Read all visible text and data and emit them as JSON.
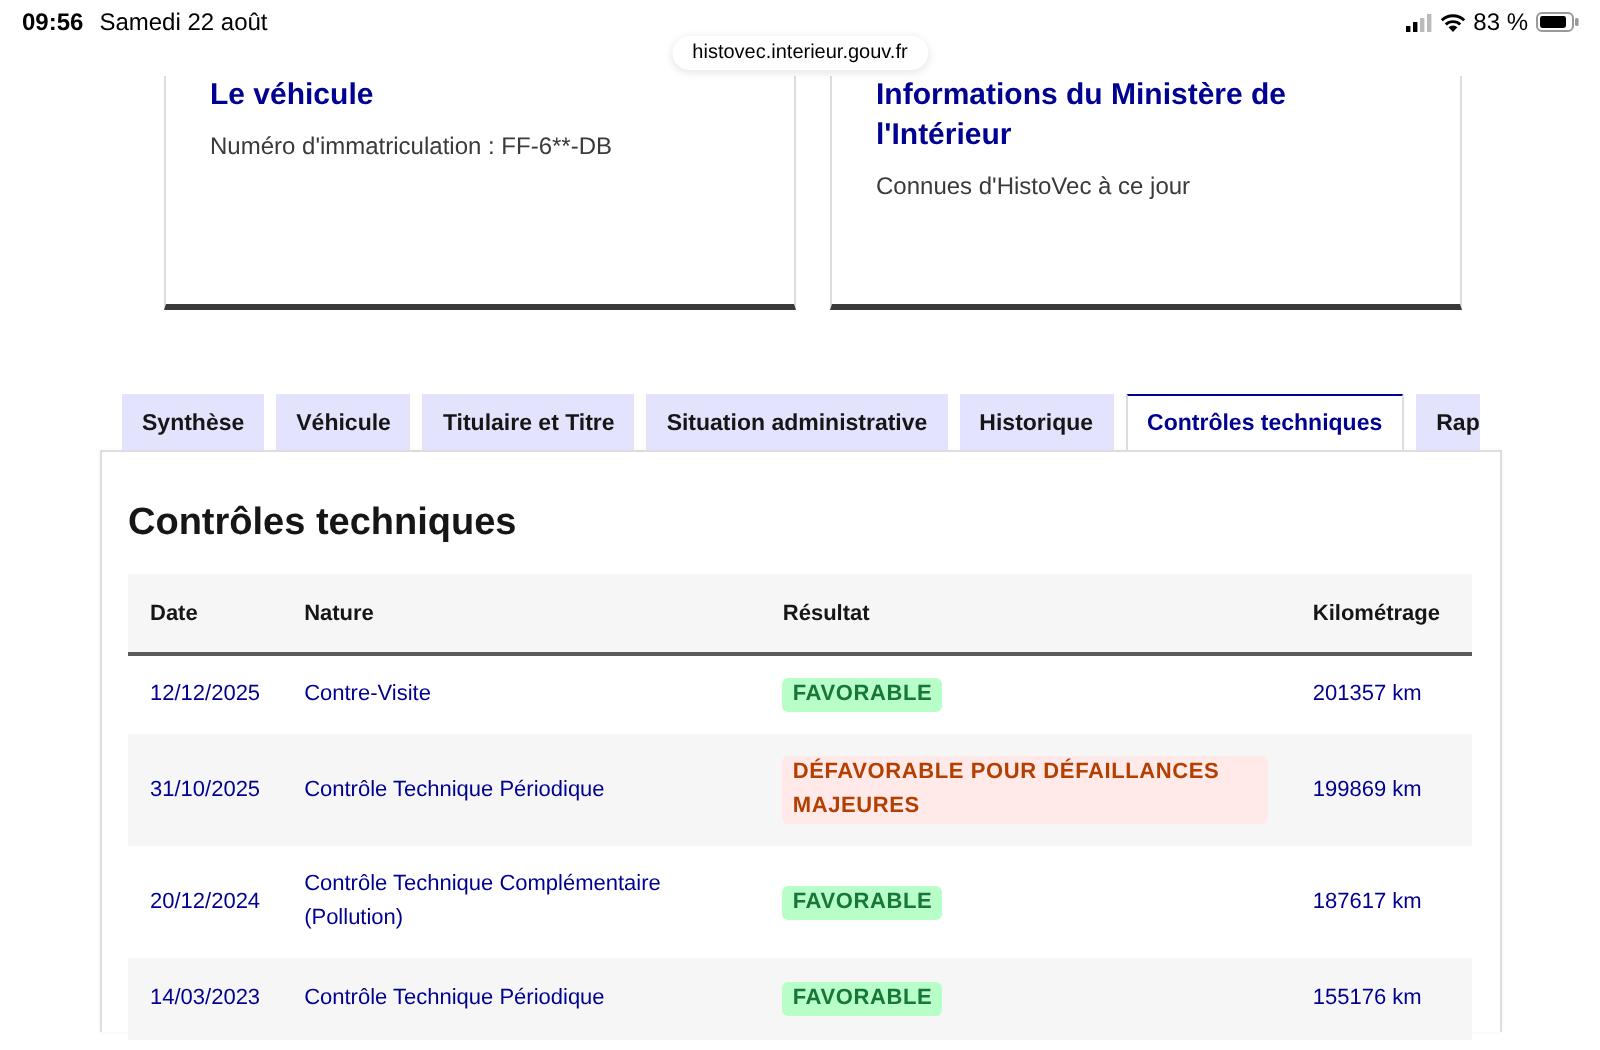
{
  "status_bar": {
    "time": "09:56",
    "date": "Samedi 22 août",
    "battery": "83 %"
  },
  "address_bar": {
    "url": "histovec.interieur.gouv.fr"
  },
  "cards": [
    {
      "title": "Le véhicule",
      "text": "Numéro d'immatriculation : FF-6**-DB"
    },
    {
      "title": "Informations du Ministère de l'Intérieur",
      "text": "Connues d'HistoVec à ce jour"
    }
  ],
  "tabs": [
    {
      "label": "Synthèse",
      "selected": false
    },
    {
      "label": "Véhicule",
      "selected": false
    },
    {
      "label": "Titulaire et Titre",
      "selected": false
    },
    {
      "label": "Situation administrative",
      "selected": false
    },
    {
      "label": "Historique",
      "selected": false
    },
    {
      "label": "Contrôles techniques",
      "selected": true
    },
    {
      "label": "Rap",
      "selected": false
    }
  ],
  "section": {
    "title": "Contrôles techniques"
  },
  "table": {
    "columns": [
      "Date",
      "Nature",
      "Résultat",
      "Kilométrage"
    ],
    "rows": [
      {
        "date": "12/12/2025",
        "nature": "Contre-Visite",
        "result": {
          "label": "FAVORABLE",
          "kind": "success"
        },
        "mileage": "201357 km"
      },
      {
        "date": "31/10/2025",
        "nature": "Contrôle Technique Périodique",
        "result": {
          "label": "DÉFAVORABLE POUR DÉFAILLANCES MAJEURES",
          "kind": "error"
        },
        "mileage": "199869 km"
      },
      {
        "date": "20/12/2024",
        "nature": "Contrôle Technique Complémentaire (Pollution)",
        "result": {
          "label": "FAVORABLE",
          "kind": "success"
        },
        "mileage": "187617 km"
      },
      {
        "date": "14/03/2023",
        "nature": "Contrôle Technique Périodique",
        "result": {
          "label": "FAVORABLE",
          "kind": "success"
        },
        "mileage": "155176 km"
      }
    ]
  }
}
